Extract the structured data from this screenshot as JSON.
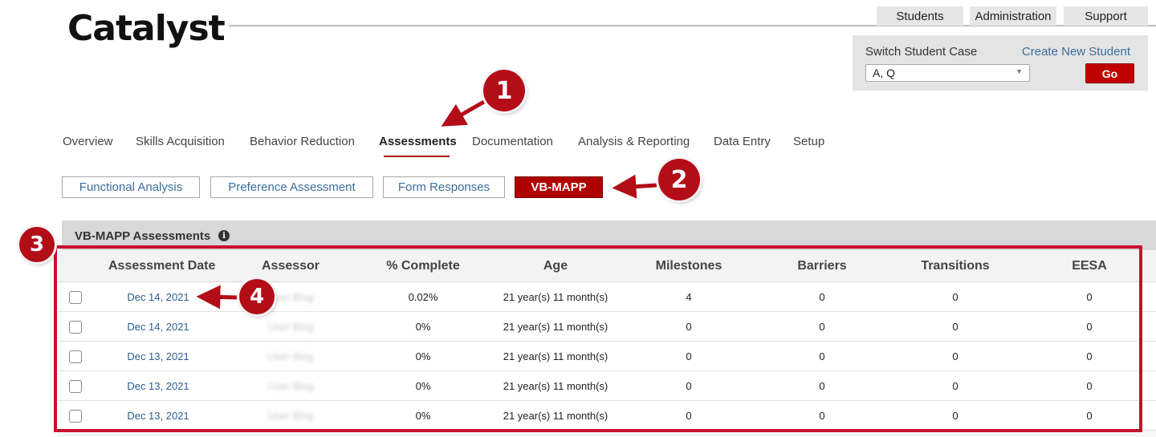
{
  "brand": {
    "logo": "Catalyst"
  },
  "top_tabs": [
    "Students",
    "Administration",
    "Support"
  ],
  "switch_case": {
    "label": "Switch Student Case",
    "create_link": "Create New Student",
    "selected_student": "A, Q",
    "go_label": "Go"
  },
  "nav": {
    "items": [
      "Overview",
      "Skills Acquisition",
      "Behavior Reduction",
      "Assessments",
      "Documentation",
      "Analysis & Reporting",
      "Data Entry",
      "Setup"
    ],
    "active": "Assessments"
  },
  "sub_nav": {
    "items": [
      "Functional Analysis",
      "Preference Assessment",
      "Form Responses",
      "VB-MAPP"
    ],
    "active": "VB-MAPP"
  },
  "panel": {
    "title": "VB-MAPP Assessments",
    "info_icon": "info-icon"
  },
  "table": {
    "columns": [
      "Assessment Date",
      "Assessor",
      "% Complete",
      "Age",
      "Milestones",
      "Barriers",
      "Transitions",
      "EESA"
    ],
    "rows": [
      {
        "date": "Dec 14, 2021",
        "assessor": "User Blog",
        "complete": "0.02%",
        "age": "21 year(s) 11 month(s)",
        "milestones": "4",
        "barriers": "0",
        "transitions": "0",
        "eesa": "0"
      },
      {
        "date": "Dec 14, 2021",
        "assessor": "User Blog",
        "complete": "0%",
        "age": "21 year(s) 11 month(s)",
        "milestones": "0",
        "barriers": "0",
        "transitions": "0",
        "eesa": "0"
      },
      {
        "date": "Dec 13, 2021",
        "assessor": "User Blog",
        "complete": "0%",
        "age": "21 year(s) 11 month(s)",
        "milestones": "0",
        "barriers": "0",
        "transitions": "0",
        "eesa": "0"
      },
      {
        "date": "Dec 13, 2021",
        "assessor": "User Blog",
        "complete": "0%",
        "age": "21 year(s) 11 month(s)",
        "milestones": "0",
        "barriers": "0",
        "transitions": "0",
        "eesa": "0"
      },
      {
        "date": "Dec 13, 2021",
        "assessor": "User Blog",
        "complete": "0%",
        "age": "21 year(s) 11 month(s)",
        "milestones": "0",
        "barriers": "0",
        "transitions": "0",
        "eesa": "0"
      }
    ]
  },
  "callouts": [
    "1",
    "2",
    "3",
    "4"
  ],
  "colors": {
    "accent_red": "#b00000",
    "link_blue": "#2b5d8f",
    "callout_red": "#b30d18"
  }
}
